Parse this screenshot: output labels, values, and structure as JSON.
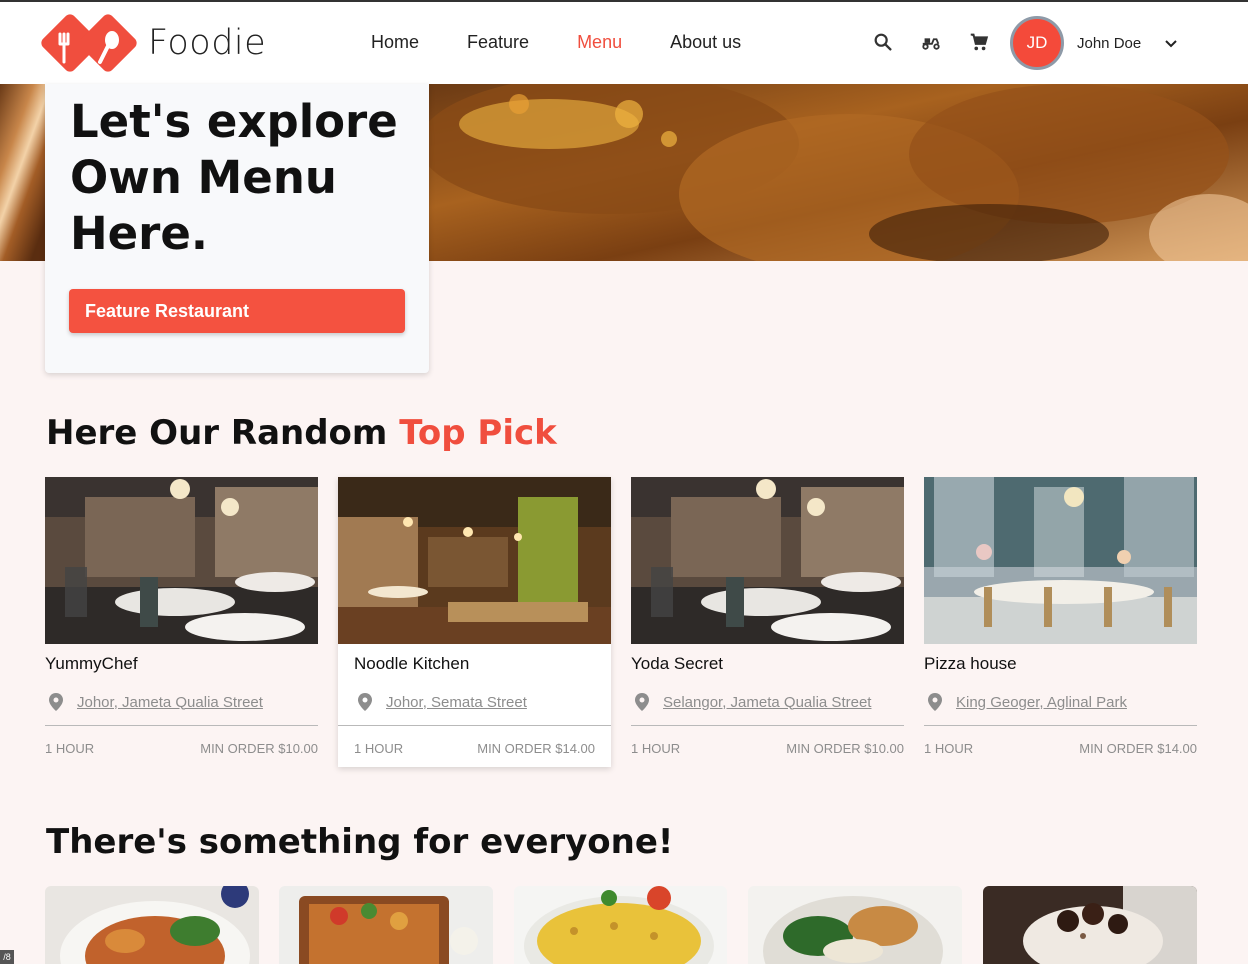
{
  "brand": {
    "name": "Foodie",
    "accent": "#f04e3e"
  },
  "nav": {
    "items": [
      {
        "label": "Home",
        "active": false
      },
      {
        "label": "Feature",
        "active": false
      },
      {
        "label": "Menu",
        "active": true
      },
      {
        "label": "About us",
        "active": false
      }
    ]
  },
  "header_icons": [
    "search-icon",
    "delivery-scooter-icon",
    "cart-icon"
  ],
  "user": {
    "initials": "JD",
    "name": "John Doe"
  },
  "hero": {
    "title": "Let's explore\nOwn Menu\nHere.",
    "button_label": "Feature Restaurant"
  },
  "top_pick": {
    "title_prefix": "Here Our Random ",
    "title_accent": "Top Pick",
    "restaurants": [
      {
        "name": "YummyChef",
        "location": "Johor, Jameta Qualia Street",
        "time": "1 HOUR",
        "min_order": "MIN ORDER $10.00"
      },
      {
        "name": "Noodle Kitchen",
        "location": "Johor, Semata Street",
        "time": "1 HOUR",
        "min_order": "MIN ORDER $14.00"
      },
      {
        "name": "Yoda Secret",
        "location": "Selangor, Jameta Qualia Street",
        "time": "1 HOUR",
        "min_order": "MIN ORDER $10.00"
      },
      {
        "name": "Pizza house",
        "location": "King Geoger, Aglinal Park",
        "time": "1 HOUR",
        "min_order": "MIN ORDER $14.00"
      }
    ]
  },
  "everyone": {
    "title": "There's something for everyone!"
  },
  "corner_tag": "/8"
}
